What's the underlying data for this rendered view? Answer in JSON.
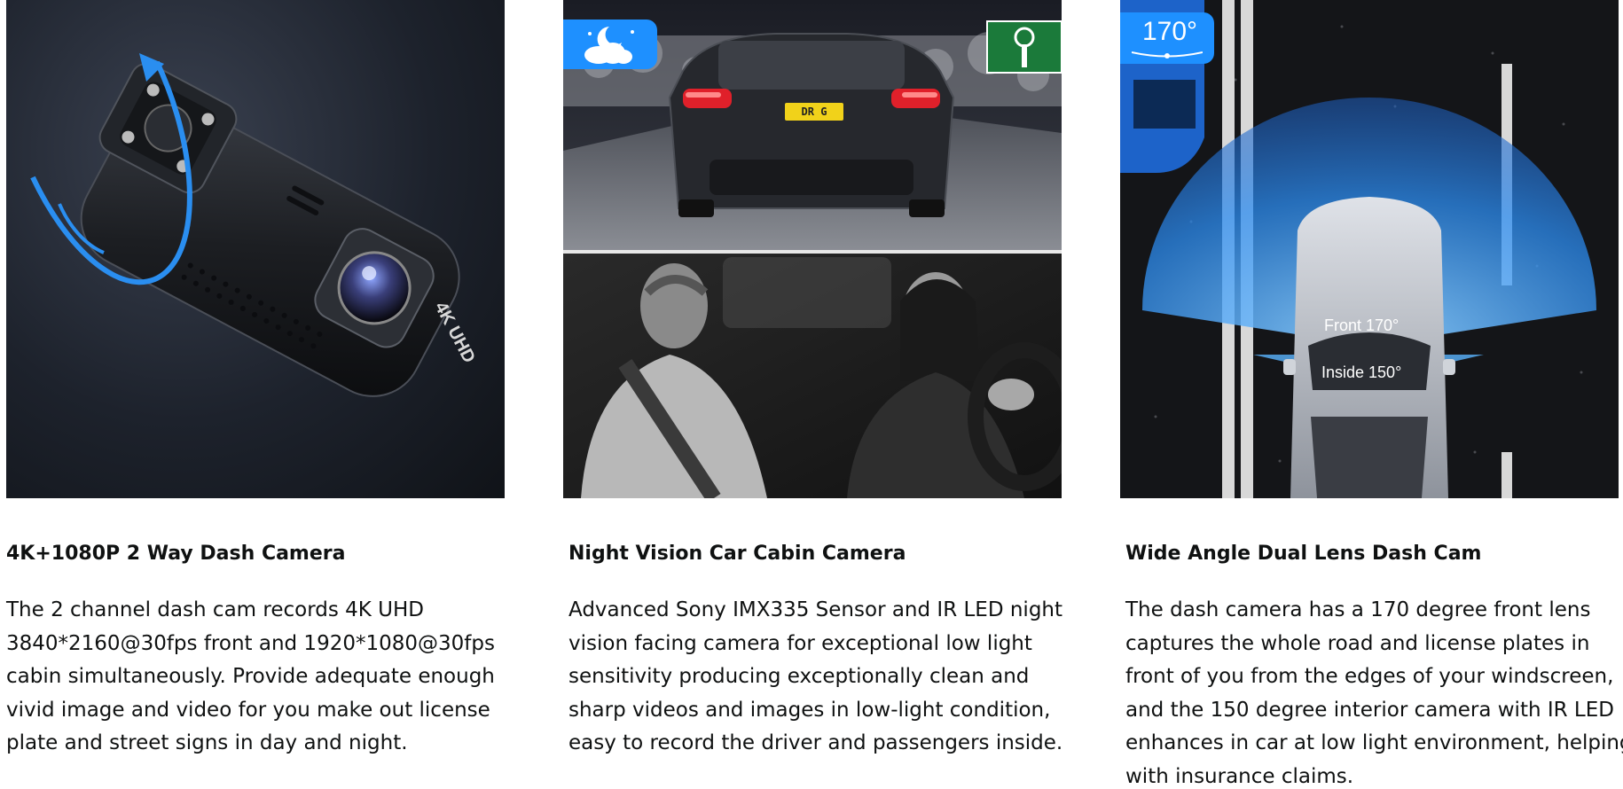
{
  "cards": [
    {
      "title": "4K+1080P 2 Way Dash Camera",
      "description": "The 2 channel dash cam records 4K UHD 3840*2160@30fps front and 1920*1080@30fps cabin simultaneously. Provide adequate enough vivid image and video for you make out license plate and street signs in day and night.",
      "image": {
        "camera_badge": "4K UHD"
      }
    },
    {
      "title": "Night Vision Car Cabin Camera",
      "description": "Advanced Sony IMX335 Sensor and IR LED night vision facing camera for exceptional low light sensitivity producing exceptionally clean and sharp videos and images in low-light condition, easy to record the driver and passengers inside.",
      "image": {
        "badge_icon": "moon-cloud-icon",
        "plate": "DR G"
      }
    },
    {
      "title": "Wide Angle Dual Lens Dash Cam",
      "description": "The dash camera has a 170 degree front lens captures the whole road and license plates in front of you from the edges of your windscreen, and the 150 degree interior camera with IR LED enhances in car at low light environment, helping with insurance claims.",
      "image": {
        "angle_badge": "170°",
        "front_label": "Front 170°",
        "inside_label": "Inside 150°"
      }
    }
  ],
  "colors": {
    "accent_blue": "#1e90ff",
    "text": "#0f1111"
  }
}
